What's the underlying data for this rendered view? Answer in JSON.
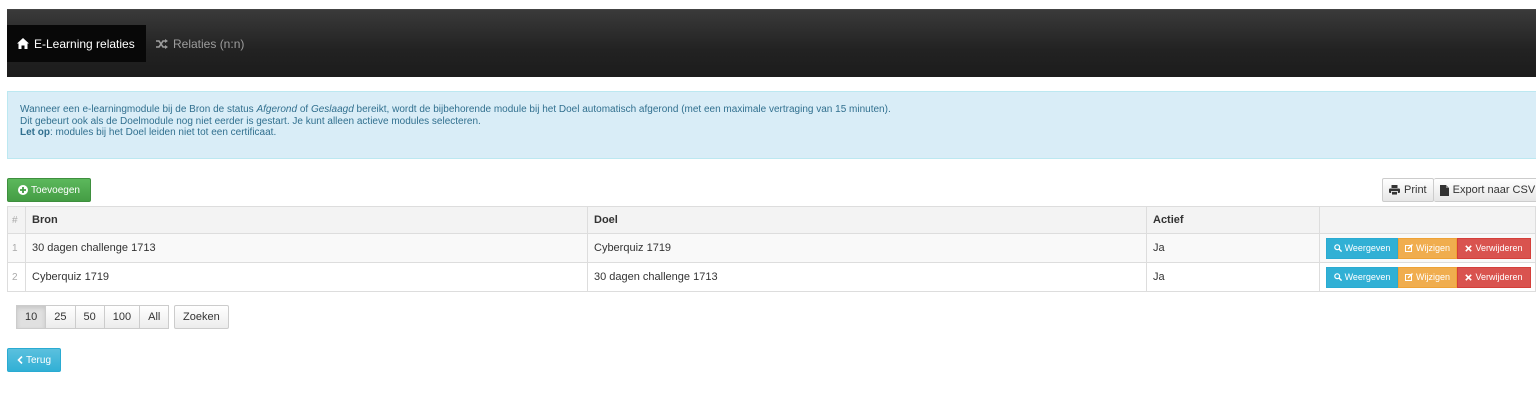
{
  "nav": {
    "tabs": [
      {
        "label": "E-Learning relaties",
        "icon": "home-icon",
        "active": true
      },
      {
        "label": "Relaties (n:n)",
        "icon": "shuffle-icon",
        "active": false
      }
    ]
  },
  "alert": {
    "line1_pre": "Wanneer een e-learningmodule bij de Bron de status ",
    "line1_em1": "Afgerond",
    "line1_mid": " of ",
    "line1_em2": "Geslaagd",
    "line1_post": " bereikt, wordt de bijbehorende module bij het Doel automatisch afgerond (met een maximale vertraging van 15 minuten).",
    "line2": "Dit gebeurt ook als de Doelmodule nog niet eerder is gestart. Je kunt alleen actieve modules selecteren.",
    "line3_bold": "Let op",
    "line3_rest": ": modules bij het Doel leiden niet tot een certificaat."
  },
  "toolbar": {
    "add_label": "Toevoegen",
    "print_label": "Print",
    "export_label": "Export naar CSV"
  },
  "table": {
    "headers": {
      "index": "#",
      "bron": "Bron",
      "doel": "Doel",
      "actief": "Actief"
    },
    "rows": [
      {
        "index": "1",
        "bron": "30 dagen challenge 1713",
        "doel": "Cyberquiz 1719",
        "actief": "Ja"
      },
      {
        "index": "2",
        "bron": "Cyberquiz 1719",
        "doel": "30 dagen challenge 1713",
        "actief": "Ja"
      }
    ],
    "actions": {
      "view": "Weergeven",
      "edit": "Wijzigen",
      "delete": "Verwijderen"
    }
  },
  "pager": {
    "sizes": [
      "10",
      "25",
      "50",
      "100",
      "All"
    ],
    "selected": "10",
    "search_label": "Zoeken"
  },
  "back_label": "Terug",
  "colors": {
    "navbar": "#222222",
    "alert_bg": "#d9edf7",
    "alert_text": "#31708f",
    "success": "#5cb85c",
    "info": "#31b0d5",
    "warning": "#f0ad4e",
    "danger": "#d9534f"
  }
}
